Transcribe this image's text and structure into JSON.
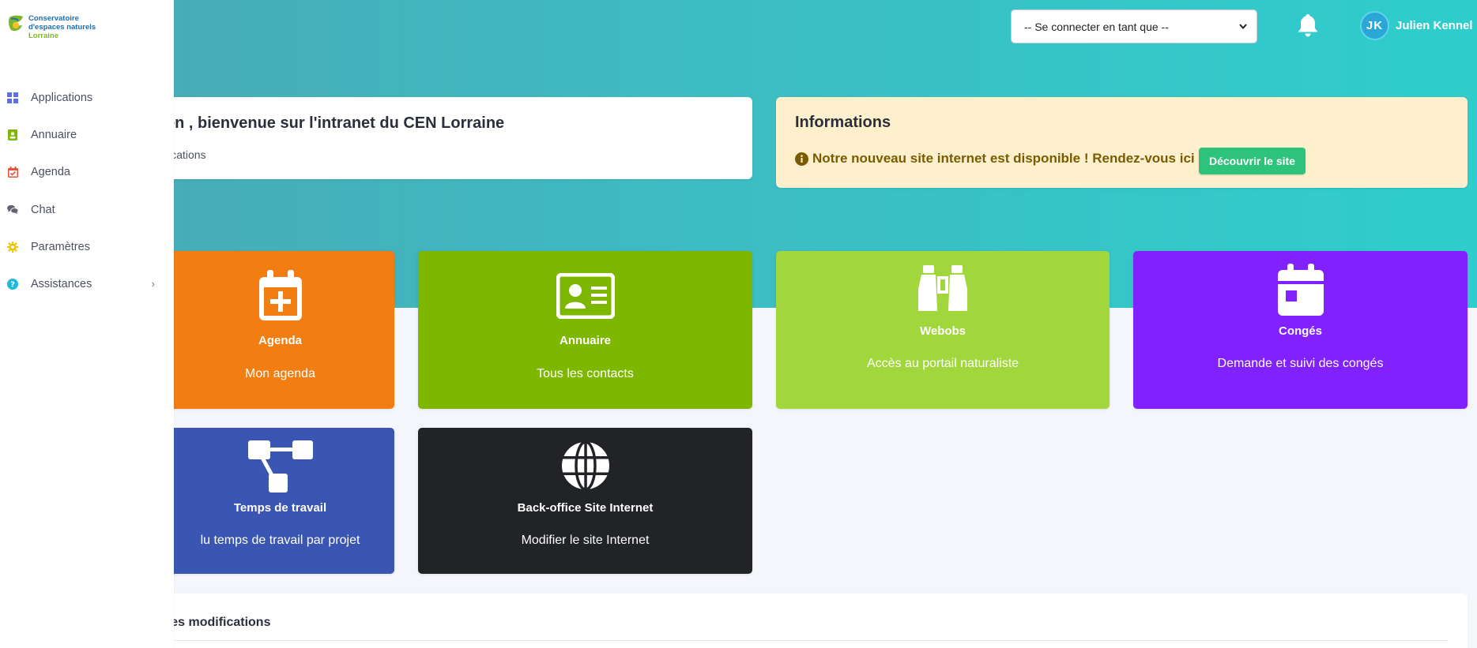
{
  "sidebar": {
    "logo": {
      "line1": "Conservatoire",
      "line2": "d'espaces naturels",
      "line3": "Lorraine"
    },
    "items": [
      {
        "label": "Applications",
        "icon": "grid-icon",
        "color": "#5b6ef5"
      },
      {
        "label": "Annuaire",
        "icon": "contact-card-icon",
        "color": "#7fb800"
      },
      {
        "label": "Agenda",
        "icon": "calendar-check-icon",
        "color": "#e8523c"
      },
      {
        "label": "Chat",
        "icon": "chat-bubbles-icon",
        "color": "#5f6470"
      },
      {
        "label": "Paramètres",
        "icon": "gear-icon",
        "color": "#f2c200"
      },
      {
        "label": "Assistances",
        "icon": "help-circle-icon",
        "color": "#1fb6e0",
        "chevron": "›"
      }
    ]
  },
  "topbar": {
    "login_as_select": {
      "value": "-- Se connecter en tant que --"
    },
    "notifications_icon": "bell-icon",
    "user": {
      "initials": "JK",
      "name": "Julien Kennel"
    }
  },
  "welcome": {
    "title": "en , bienvenue sur l'intranet du CEN Lorraine",
    "subtitle": "lications"
  },
  "info": {
    "title": "Informations",
    "message": "Notre nouveau site internet est disponible ! Rendez-vous ici",
    "button_label": "Découvrir le site"
  },
  "tiles": [
    {
      "title": "Agenda",
      "subtitle": "Mon agenda",
      "icon": "calendar-plus-icon",
      "color": "#f27e13"
    },
    {
      "title": "Annuaire",
      "subtitle": "Tous les contacts",
      "icon": "contact-card-icon",
      "color": "#7eb700"
    },
    {
      "title": "Webobs",
      "subtitle": "Accès au portail naturaliste",
      "icon": "binoculars-icon",
      "color": "#a1d63d"
    },
    {
      "title": "Congés",
      "subtitle": "Demande et suivi des congés",
      "icon": "calendar-day-icon",
      "color": "#8121fd"
    },
    {
      "title": "Temps de travail",
      "subtitle": "lu temps de travail par projet",
      "icon": "sitemap-icon",
      "color": "#3b55b3"
    },
    {
      "title": "Back-office Site Internet",
      "subtitle": "Modifier le site Internet",
      "icon": "globe-icon",
      "color": "#212327"
    }
  ],
  "recent": {
    "title": "res modifications"
  }
}
